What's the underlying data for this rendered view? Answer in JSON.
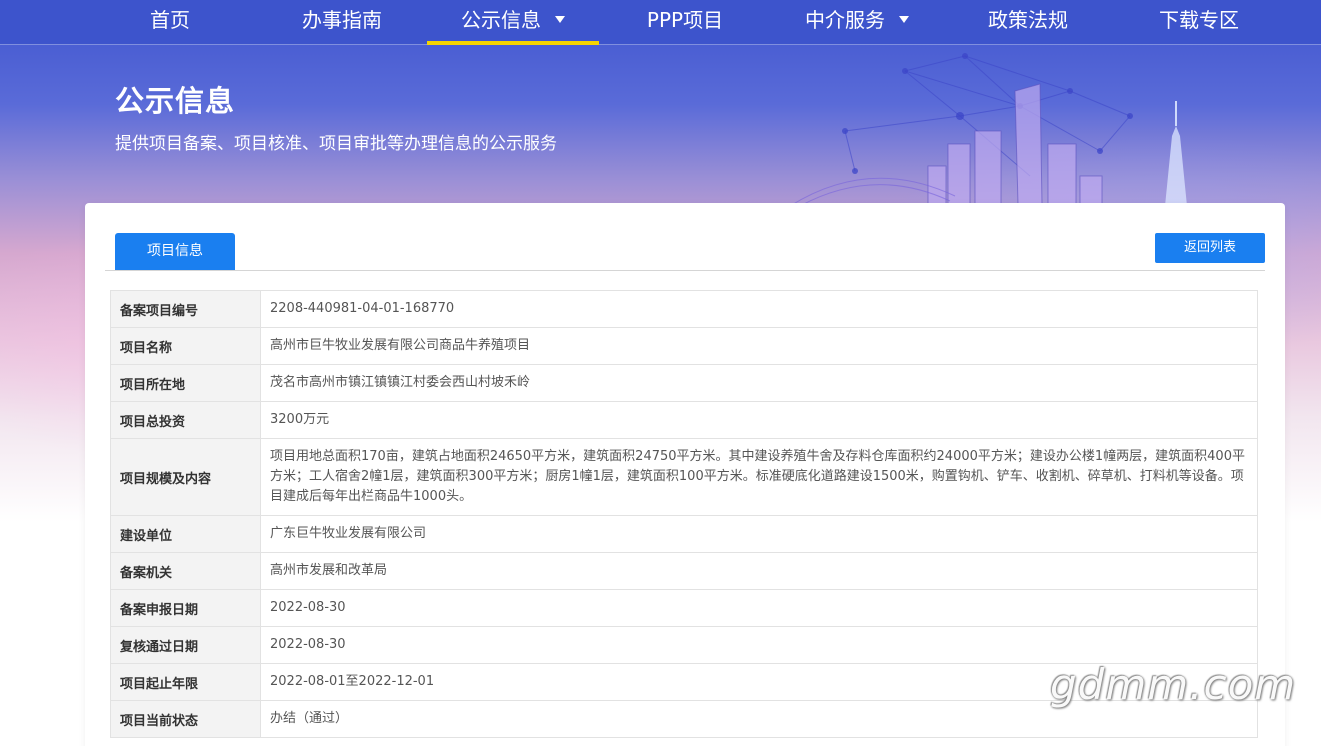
{
  "nav": {
    "items": [
      {
        "label": "首页"
      },
      {
        "label": "办事指南"
      },
      {
        "label": "公示信息"
      },
      {
        "label": "PPP项目"
      },
      {
        "label": "中介服务"
      },
      {
        "label": "政策法规"
      },
      {
        "label": "下载专区"
      }
    ],
    "active": "公示信息",
    "accent_color": "#f5d400",
    "bg_color": "#3d54cc"
  },
  "hero": {
    "title": "公示信息",
    "subtitle": "提供项目备案、项目核准、项目审批等办理信息的公示服务"
  },
  "card": {
    "tab_label": "项目信息",
    "back_button_label": "返回列表",
    "button_color": "#1a7ff0"
  },
  "info_rows": [
    {
      "label": "备案项目编号",
      "value": "2208-440981-04-01-168770"
    },
    {
      "label": "项目名称",
      "value": "高州市巨牛牧业发展有限公司商品牛养殖项目"
    },
    {
      "label": "项目所在地",
      "value": "茂名市高州市镇江镇镇江村委会西山村坡禾岭"
    },
    {
      "label": "项目总投资",
      "value": "3200万元"
    },
    {
      "label": "项目规模及内容",
      "value": "项目用地总面积170亩，建筑占地面积24650平方米，建筑面积24750平方米。其中建设养殖牛舍及存料仓库面积约24000平方米；建设办公楼1幢两层，建筑面积400平方米；工人宿舍2幢1层，建筑面积300平方米；厨房1幢1层，建筑面积100平方米。标准硬底化道路建设1500米，购置钩机、铲车、收割机、碎草机、打料机等设备。项目建成后每年出栏商品牛1000头。"
    },
    {
      "label": "建设单位",
      "value": "广东巨牛牧业发展有限公司"
    },
    {
      "label": "备案机关",
      "value": "高州市发展和改革局"
    },
    {
      "label": "备案申报日期",
      "value": "2022-08-30"
    },
    {
      "label": "复核通过日期",
      "value": "2022-08-30"
    },
    {
      "label": "项目起止年限",
      "value": "2022-08-01至2022-12-01"
    },
    {
      "label": "项目当前状态",
      "value": "办结（通过）"
    }
  ],
  "watermark": "gdmm.com"
}
